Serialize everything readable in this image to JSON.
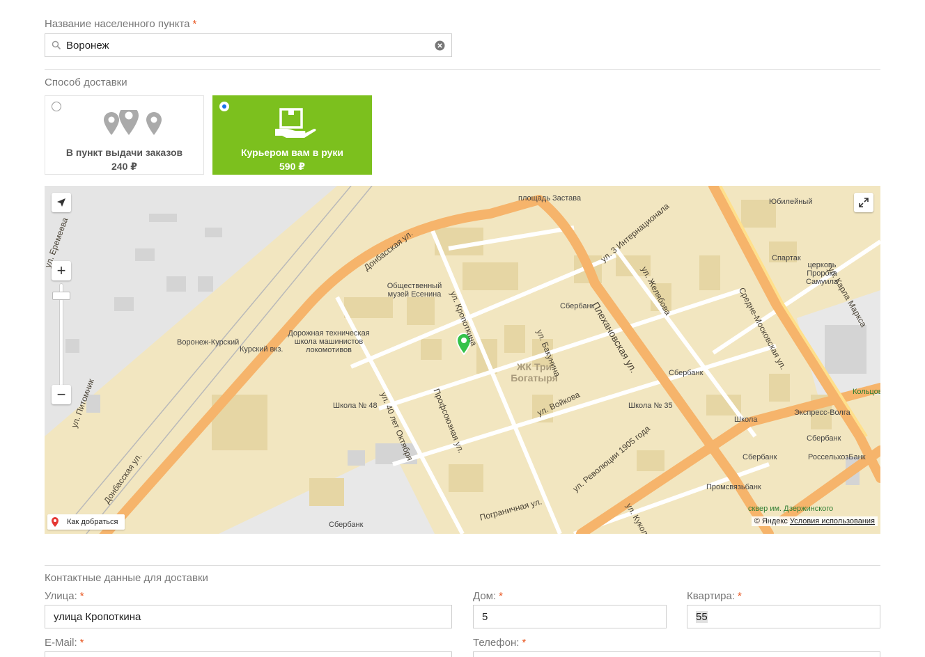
{
  "settlement": {
    "label": "Название населенного пункта",
    "required": "*",
    "value": "Воронеж"
  },
  "delivery": {
    "label": "Способ доставки",
    "options": [
      {
        "title": "В пункт выдачи заказов",
        "price": "240 ₽",
        "selected": false
      },
      {
        "title": "Курьером вам в руки",
        "price": "590 ₽",
        "selected": true
      }
    ]
  },
  "map": {
    "route_label": "Как добраться",
    "copyright": "© Яндекс",
    "terms": "Условия использования",
    "streets": [
      "Донбасская ул.",
      "Плехановская ул.",
      "ул. Кропоткина",
      "ул. 40 лет Октября",
      "Профсоюзная ул.",
      "ул. Войкова",
      "ул. Бакунина",
      "ул. Революции 1905 года",
      "Пограничная ул.",
      "Средне-Московская ул.",
      "ул. Желябова",
      "ул. 3 Интернационала",
      "ул. Карла Маркса",
      "ул. Питомник",
      "ул. Куколкина",
      "ул. Еремеева"
    ],
    "places": [
      "площадь Застава",
      "Юбилейный",
      "Спартак",
      "церковь Пророка Самуила",
      "Общественный музей Есенина",
      "Дорожная техническая школа машинистов локомотивов",
      "Воронеж-Курский",
      "Курский вкз.",
      "ЖК Три Богатыря",
      "Школа № 48",
      "Школа № 35",
      "Школа",
      "Сбербанк",
      "Экспресс-Волга",
      "РоссельхозБанк",
      "Промсвязьбанк",
      "Кольцовский бульвар",
      "сквер им. Дзержинского"
    ]
  },
  "contacts": {
    "label": "Контактные данные для доставки",
    "street": {
      "label": "Улица:",
      "value": "улица Кропоткина"
    },
    "house": {
      "label": "Дом:",
      "value": "5"
    },
    "apartment": {
      "label": "Квартира:",
      "value": "55"
    },
    "email": {
      "label": "E-Mail:",
      "value": ""
    },
    "phone": {
      "label": "Телефон:",
      "value": ""
    }
  },
  "colors": {
    "accent": "#7cc01e",
    "required": "#e8541e",
    "road": "#f6b46b",
    "map_bg": "#f2e6c0"
  }
}
